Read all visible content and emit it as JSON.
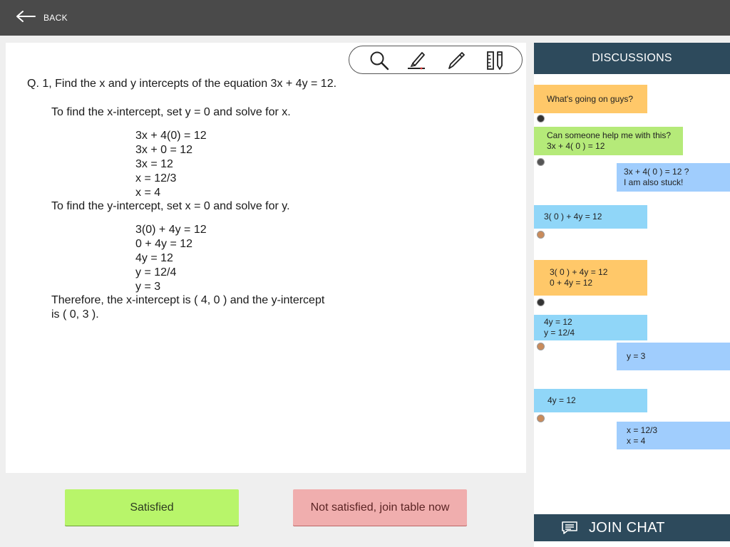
{
  "topbar": {
    "back_label": "BACK"
  },
  "toolbar": {
    "icons": [
      "search-icon",
      "highlighter-icon",
      "pen-icon",
      "ruler-icon"
    ]
  },
  "question": {
    "title": "Q. 1, Find the x and y intercepts of the equation 3x + 4y = 12.",
    "x_intro": "To find the x-intercept, set y = 0 and solve for x.",
    "x_steps": [
      "3x + 4(0) = 12",
      "3x + 0 = 12",
      "3x = 12",
      "x = 12/3",
      "x = 4"
    ],
    "y_intro": "To find the y-intercept, set x = 0 and solve for y.",
    "y_steps": [
      "3(0) + 4y = 12",
      "0 + 4y = 12",
      "4y = 12",
      "y = 12/4",
      "y = 3"
    ],
    "conclusion_1": "Therefore, the x-intercept is ( 4, 0 ) and the y-intercept",
    "conclusion_2": "is ( 0, 3 )."
  },
  "actions": {
    "satisfied": "Satisfied",
    "not_satisfied": "Not satisfied, join table now"
  },
  "discussions": {
    "title": "DISCUSSIONS",
    "join_label": "JOIN CHAT",
    "colors": {
      "orange": "#ffc869",
      "green": "#b5ea79",
      "blue": "#a0cdfd",
      "cyan": "#90d6f8"
    },
    "messages": [
      {
        "lines": [
          "What's going on guys?"
        ],
        "side": "left",
        "color": "orange"
      },
      {
        "lines": [
          "Can someone help me with this?",
          "3x + 4( 0 ) = 12"
        ],
        "side": "left",
        "color": "green"
      },
      {
        "lines": [
          "3x + 4( 0 ) = 12 ?",
          "I am also stuck!"
        ],
        "side": "right",
        "color": "blue"
      },
      {
        "lines": [
          "3( 0 ) + 4y = 12"
        ],
        "side": "left",
        "color": "cyan"
      },
      {
        "lines": [
          "3( 0 ) + 4y = 12",
          "0 + 4y = 12"
        ],
        "side": "left",
        "color": "orange"
      },
      {
        "lines": [
          "4y = 12",
          "y = 12/4"
        ],
        "side": "left",
        "color": "cyan"
      },
      {
        "lines": [
          "y = 3"
        ],
        "side": "right",
        "color": "blue"
      },
      {
        "lines": [
          "4y = 12"
        ],
        "side": "left",
        "color": "cyan"
      },
      {
        "lines": [
          "x = 12/3",
          "x = 4"
        ],
        "side": "right",
        "color": "blue"
      }
    ]
  }
}
